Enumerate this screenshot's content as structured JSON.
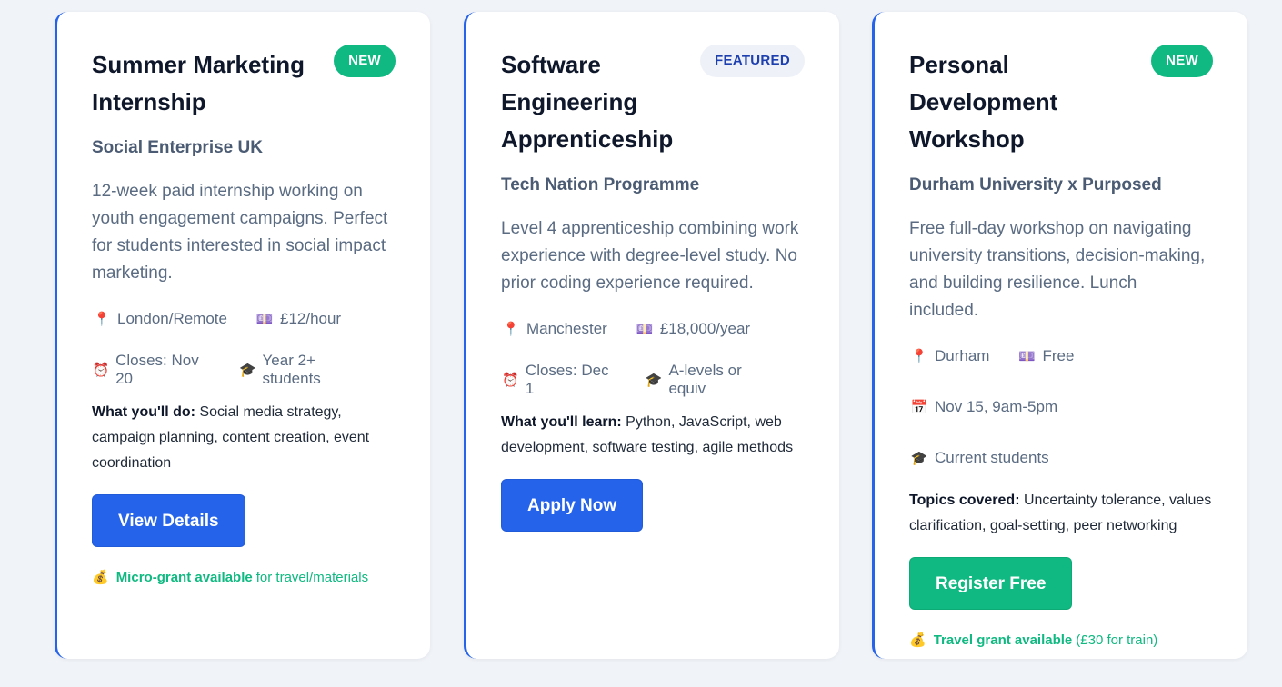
{
  "cards": [
    {
      "badge": "NEW",
      "title": "Summer Marketing Internship",
      "org": "Social Enterprise UK",
      "description": "12-week paid internship working on youth engagement campaigns. Perfect for students interested in social impact marketing.",
      "meta": [
        [
          {
            "icon": "pin-icon",
            "glyph": "📍",
            "text": "London/Remote"
          },
          {
            "icon": "money-icon",
            "glyph": "💷",
            "text": "£12/hour"
          }
        ],
        [
          {
            "icon": "alarm-clock-icon",
            "glyph": "⏰",
            "text": "Closes: Nov 20"
          },
          {
            "icon": "graduation-cap-icon",
            "glyph": "🎓",
            "text": "Year 2+ students"
          }
        ]
      ],
      "detail_label": "What you'll do:",
      "detail_text": "Social media strategy, campaign planning, content creation, event coordination",
      "button": "View Details",
      "grant_icon": "money-bag-icon",
      "grant_glyph": "💰",
      "grant_bold": "Micro-grant available",
      "grant_text": "for travel/materials"
    },
    {
      "badge": "FEATURED",
      "title": "Software Engineering Apprenticeship",
      "org": "Tech Nation Programme",
      "description": "Level 4 apprenticeship combining work experience with degree-level study. No prior coding experience required.",
      "meta": [
        [
          {
            "icon": "pin-icon",
            "glyph": "📍",
            "text": "Manchester"
          },
          {
            "icon": "money-icon",
            "glyph": "💷",
            "text": "£18,000/year"
          }
        ],
        [
          {
            "icon": "alarm-clock-icon",
            "glyph": "⏰",
            "text": "Closes: Dec 1"
          },
          {
            "icon": "graduation-cap-icon",
            "glyph": "🎓",
            "text": "A-levels or equiv"
          }
        ]
      ],
      "detail_label": "What you'll learn:",
      "detail_text": "Python, JavaScript, web development, software testing, agile methods",
      "button": "Apply Now"
    },
    {
      "badge": "NEW",
      "title": "Personal Development Workshop",
      "org": "Durham University x Purposed",
      "description": "Free full-day workshop on navigating university transitions, decision-making, and building resilience. Lunch included.",
      "meta": [
        [
          {
            "icon": "pin-icon",
            "glyph": "📍",
            "text": "Durham"
          },
          {
            "icon": "money-icon",
            "glyph": "💷",
            "text": "Free"
          }
        ],
        [
          {
            "icon": "calendar-icon",
            "glyph": "📅",
            "text": "Nov 15, 9am-5pm"
          }
        ],
        [
          {
            "icon": "graduation-cap-icon",
            "glyph": "🎓",
            "text": "Current students"
          }
        ]
      ],
      "detail_label": "Topics covered:",
      "detail_text": "Uncertainty tolerance, values clarification, goal-setting, peer networking",
      "button": "Register Free",
      "grant_icon": "money-bag-icon",
      "grant_glyph": "💰",
      "grant_bold": "Travel grant available",
      "grant_text": "(£30 for train)"
    }
  ],
  "colors": {
    "accent": "#2563eb",
    "success": "#10b981",
    "title": "#0f172a",
    "muted": "#5a6b82",
    "page_bg": "#f0f3f8"
  }
}
